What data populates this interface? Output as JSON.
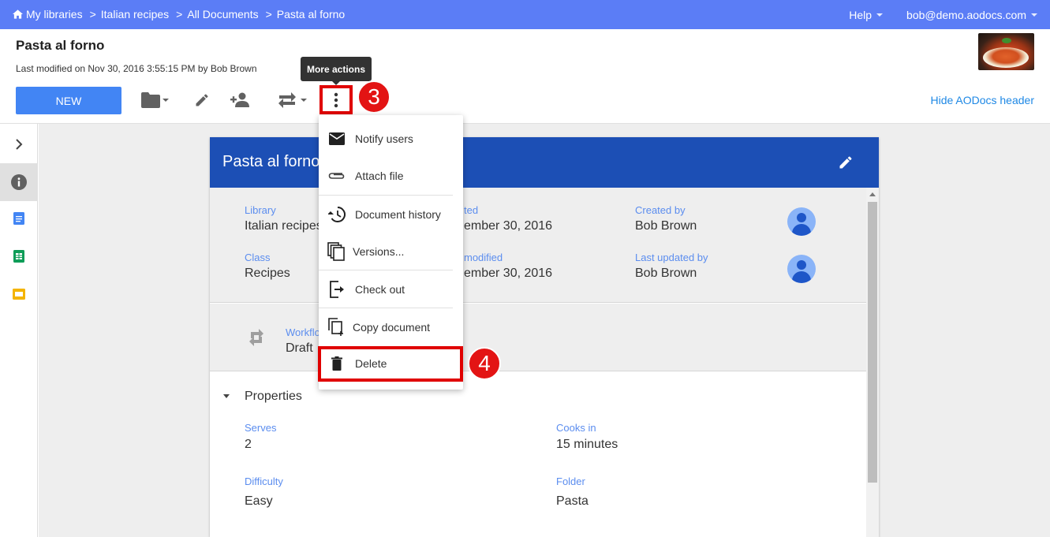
{
  "breadcrumb": {
    "items": [
      "My libraries",
      "Italian recipes",
      "All Documents",
      "Pasta al forno"
    ],
    "separator": ">"
  },
  "topbar": {
    "help_label": "Help",
    "user_email": "bob@demo.aodocs.com",
    "bg_color": "#5b7df6"
  },
  "document": {
    "title": "Pasta al forno",
    "modified_line": "Last modified on Nov 30, 2016 3:55:15 PM by Bob Brown"
  },
  "toolbar": {
    "new_label": "NEW",
    "more_actions_tooltip": "More actions",
    "hide_header_label": "Hide AODocs header",
    "icons": [
      "folder-icon",
      "pencil-icon",
      "add-person-icon",
      "workflow-icon",
      "more-vert-icon"
    ]
  },
  "annotations": {
    "step_3": "3",
    "step_4": "4",
    "highlight_color": "#e00000"
  },
  "menu": {
    "items": [
      {
        "label": "Notify users",
        "icon": "mail-icon"
      },
      {
        "label": "Attach file",
        "icon": "paperclip-icon"
      },
      {
        "label": "Document history",
        "icon": "history-icon"
      },
      {
        "label": "Versions...",
        "icon": "versions-icon"
      },
      {
        "label": "Check out",
        "icon": "checkout-icon"
      },
      {
        "label": "Copy document",
        "icon": "copy-icon"
      },
      {
        "label": "Delete",
        "icon": "trash-icon"
      }
    ]
  },
  "card": {
    "title": "Pasta al forno",
    "header_color": "#1c4fb5",
    "fields": {
      "library_label": "Library",
      "library_value": "Italian recipes",
      "created_label_partial": "ted",
      "created_value_partial": "ember 30, 2016",
      "created_by_label": "Created by",
      "created_by_value": "Bob Brown",
      "class_label": "Class",
      "class_value": "Recipes",
      "modified_label_partial": "modified",
      "modified_value_partial": "ember 30, 2016",
      "last_updated_by_label": "Last updated by",
      "last_updated_by_value": "Bob Brown",
      "workflow_label_partial": "Workflo",
      "workflow_value": "Draft"
    },
    "properties": {
      "section_title": "Properties",
      "items": [
        {
          "label": "Serves",
          "value": "2"
        },
        {
          "label": "Cooks in",
          "value": "15 minutes"
        },
        {
          "label": "Difficulty",
          "value": "Easy"
        },
        {
          "label": "Folder",
          "value": "Pasta"
        }
      ]
    }
  },
  "rail": {
    "items": [
      "chevron-right-icon",
      "info-icon",
      "docs-icon",
      "sheets-icon",
      "slides-icon"
    ]
  }
}
